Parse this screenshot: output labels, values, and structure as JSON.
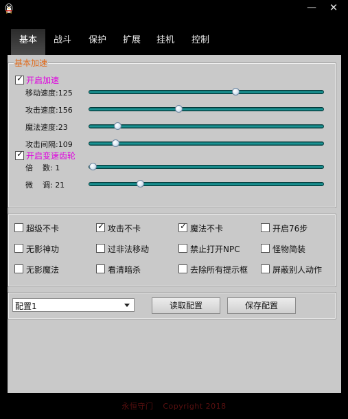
{
  "window": {
    "minimize_label": "—",
    "close_label": "✕"
  },
  "tabs": [
    "基本",
    "战斗",
    "保护",
    "扩展",
    "挂机",
    "控制"
  ],
  "accel_group": {
    "title": "基本加速",
    "enable_accel": {
      "label": "开启加速",
      "checked": true
    },
    "sliders": [
      {
        "label": "移动速度:125",
        "level": 0.63
      },
      {
        "label": "攻击速度:156",
        "level": 0.38
      },
      {
        "label": "魔法速度:23",
        "level": 0.11
      },
      {
        "label": "攻击间隔:109",
        "level": 0.1
      }
    ],
    "enable_gear": {
      "label": "开启变速齿轮",
      "checked": true
    },
    "gear_sliders": [
      {
        "label": "倍    数: 1",
        "level": 0.0
      },
      {
        "label": "微    调: 21",
        "level": 0.21
      }
    ]
  },
  "options": [
    {
      "label": "超级不卡",
      "checked": false
    },
    {
      "label": "攻击不卡",
      "checked": true
    },
    {
      "label": "魔法不卡",
      "checked": true
    },
    {
      "label": "开启76步",
      "checked": false
    },
    {
      "label": "无影神功",
      "checked": false
    },
    {
      "label": "过非法移动",
      "checked": false
    },
    {
      "label": "禁止打开NPC",
      "checked": false
    },
    {
      "label": "怪物简装",
      "checked": false
    },
    {
      "label": "无影魔法",
      "checked": false
    },
    {
      "label": "看清暗杀",
      "checked": false
    },
    {
      "label": "去除所有提示框",
      "checked": false
    },
    {
      "label": "屏蔽别人动作",
      "checked": false
    }
  ],
  "config": {
    "selected": "配置1",
    "read_label": "读取配置",
    "save_label": "保存配置"
  },
  "footer": {
    "left": "永恒守门",
    "right": "Copyright 2018"
  },
  "colors": {
    "group_title": "#e06a1a",
    "pink_label": "#e000e0",
    "track": "#1fa4a4"
  }
}
